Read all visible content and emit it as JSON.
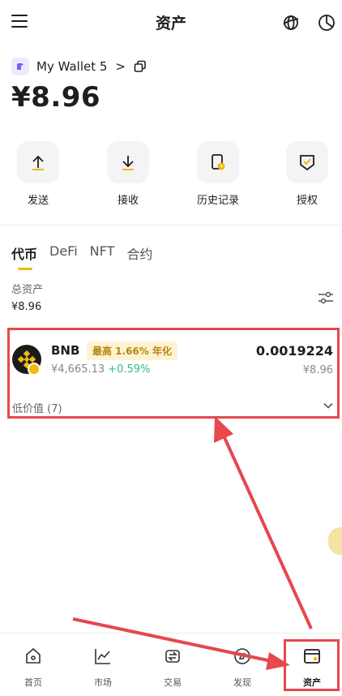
{
  "header": {
    "title": "资产",
    "menu_icon": "menu-icon",
    "network_icon": "globe-icon",
    "chart_icon": "pie-chart-icon"
  },
  "wallet": {
    "name": "My Wallet 5",
    "chevron": ">",
    "balance": "¥8.96"
  },
  "actions": [
    {
      "label": "发送",
      "icon": "send-icon"
    },
    {
      "label": "接收",
      "icon": "receive-icon"
    },
    {
      "label": "历史记录",
      "icon": "history-icon"
    },
    {
      "label": "授权",
      "icon": "authorize-icon"
    }
  ],
  "tabs": [
    "代币",
    "DeFi",
    "NFT",
    "合约"
  ],
  "summary": {
    "label": "总资产",
    "value": "¥8.96"
  },
  "token": {
    "symbol": "BNB",
    "apy_tag": "最高 1.66% 年化",
    "price": "¥4,665.13",
    "change": "+0.59%",
    "amount": "0.0019224",
    "value": "¥8.96"
  },
  "low_value": "低价值 (7)",
  "bottom_nav": [
    {
      "label": "首页",
      "icon": "home-icon"
    },
    {
      "label": "市场",
      "icon": "market-icon"
    },
    {
      "label": "交易",
      "icon": "trade-icon"
    },
    {
      "label": "发现",
      "icon": "discover-icon"
    },
    {
      "label": "资产",
      "icon": "assets-icon"
    }
  ],
  "colors": {
    "accent": "#f0b90b",
    "positive": "#2ebd85",
    "annotation": "#e5484d"
  }
}
